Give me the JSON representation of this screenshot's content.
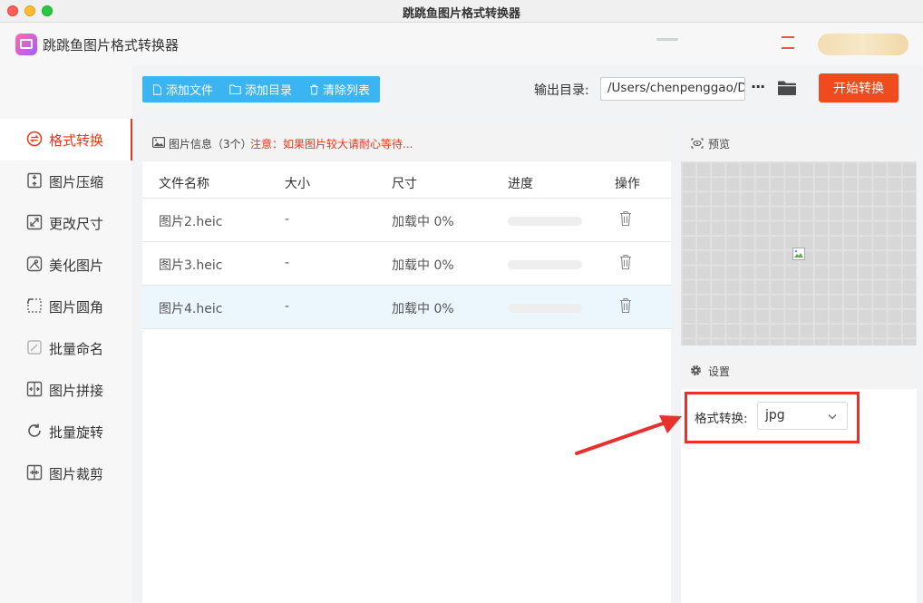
{
  "window": {
    "title": "跳跳鱼图片格式转换器"
  },
  "app": {
    "name": "跳跳鱼图片格式转换器"
  },
  "sidebar": {
    "items": [
      {
        "label": "格式转换",
        "icon": "format-convert-icon",
        "active": true
      },
      {
        "label": "图片压缩",
        "icon": "compress-icon"
      },
      {
        "label": "更改尺寸",
        "icon": "resize-icon"
      },
      {
        "label": "美化图片",
        "icon": "beautify-icon"
      },
      {
        "label": "图片圆角",
        "icon": "rounded-corner-icon"
      },
      {
        "label": "批量命名",
        "icon": "rename-icon"
      },
      {
        "label": "图片拼接",
        "icon": "stitch-icon"
      },
      {
        "label": "批量旋转",
        "icon": "rotate-icon"
      },
      {
        "label": "图片裁剪",
        "icon": "crop-icon"
      }
    ]
  },
  "toolbar": {
    "add_file": "添加文件",
    "add_folder": "添加目录",
    "clear_list": "清除列表",
    "output_label": "输出目录:",
    "output_path": "/Users/chenpenggao/D",
    "more": "···",
    "start": "开始转换"
  },
  "file_panel": {
    "info": "图片信息（3个）",
    "warning": "注意：如果图片较大请耐心等待...",
    "columns": [
      "文件名称",
      "大小",
      "尺寸",
      "进度",
      "操作"
    ],
    "rows": [
      {
        "name": "图片2.heic",
        "size": "-",
        "dim": "加载中 0%",
        "progress": 0
      },
      {
        "name": "图片3.heic",
        "size": "-",
        "dim": "加载中 0%",
        "progress": 0
      },
      {
        "name": "图片4.heic",
        "size": "-",
        "dim": "加载中 0%",
        "progress": 0,
        "selected": true
      }
    ]
  },
  "preview": {
    "title": "预览"
  },
  "settings": {
    "title": "设置",
    "format_label": "格式转换:",
    "format_value": "jpg"
  },
  "colors": {
    "accent": "#e8391b",
    "toolbar_blue": "#3bb4f2",
    "start_button": "#ef4b1f",
    "highlight": "#e8312c"
  }
}
